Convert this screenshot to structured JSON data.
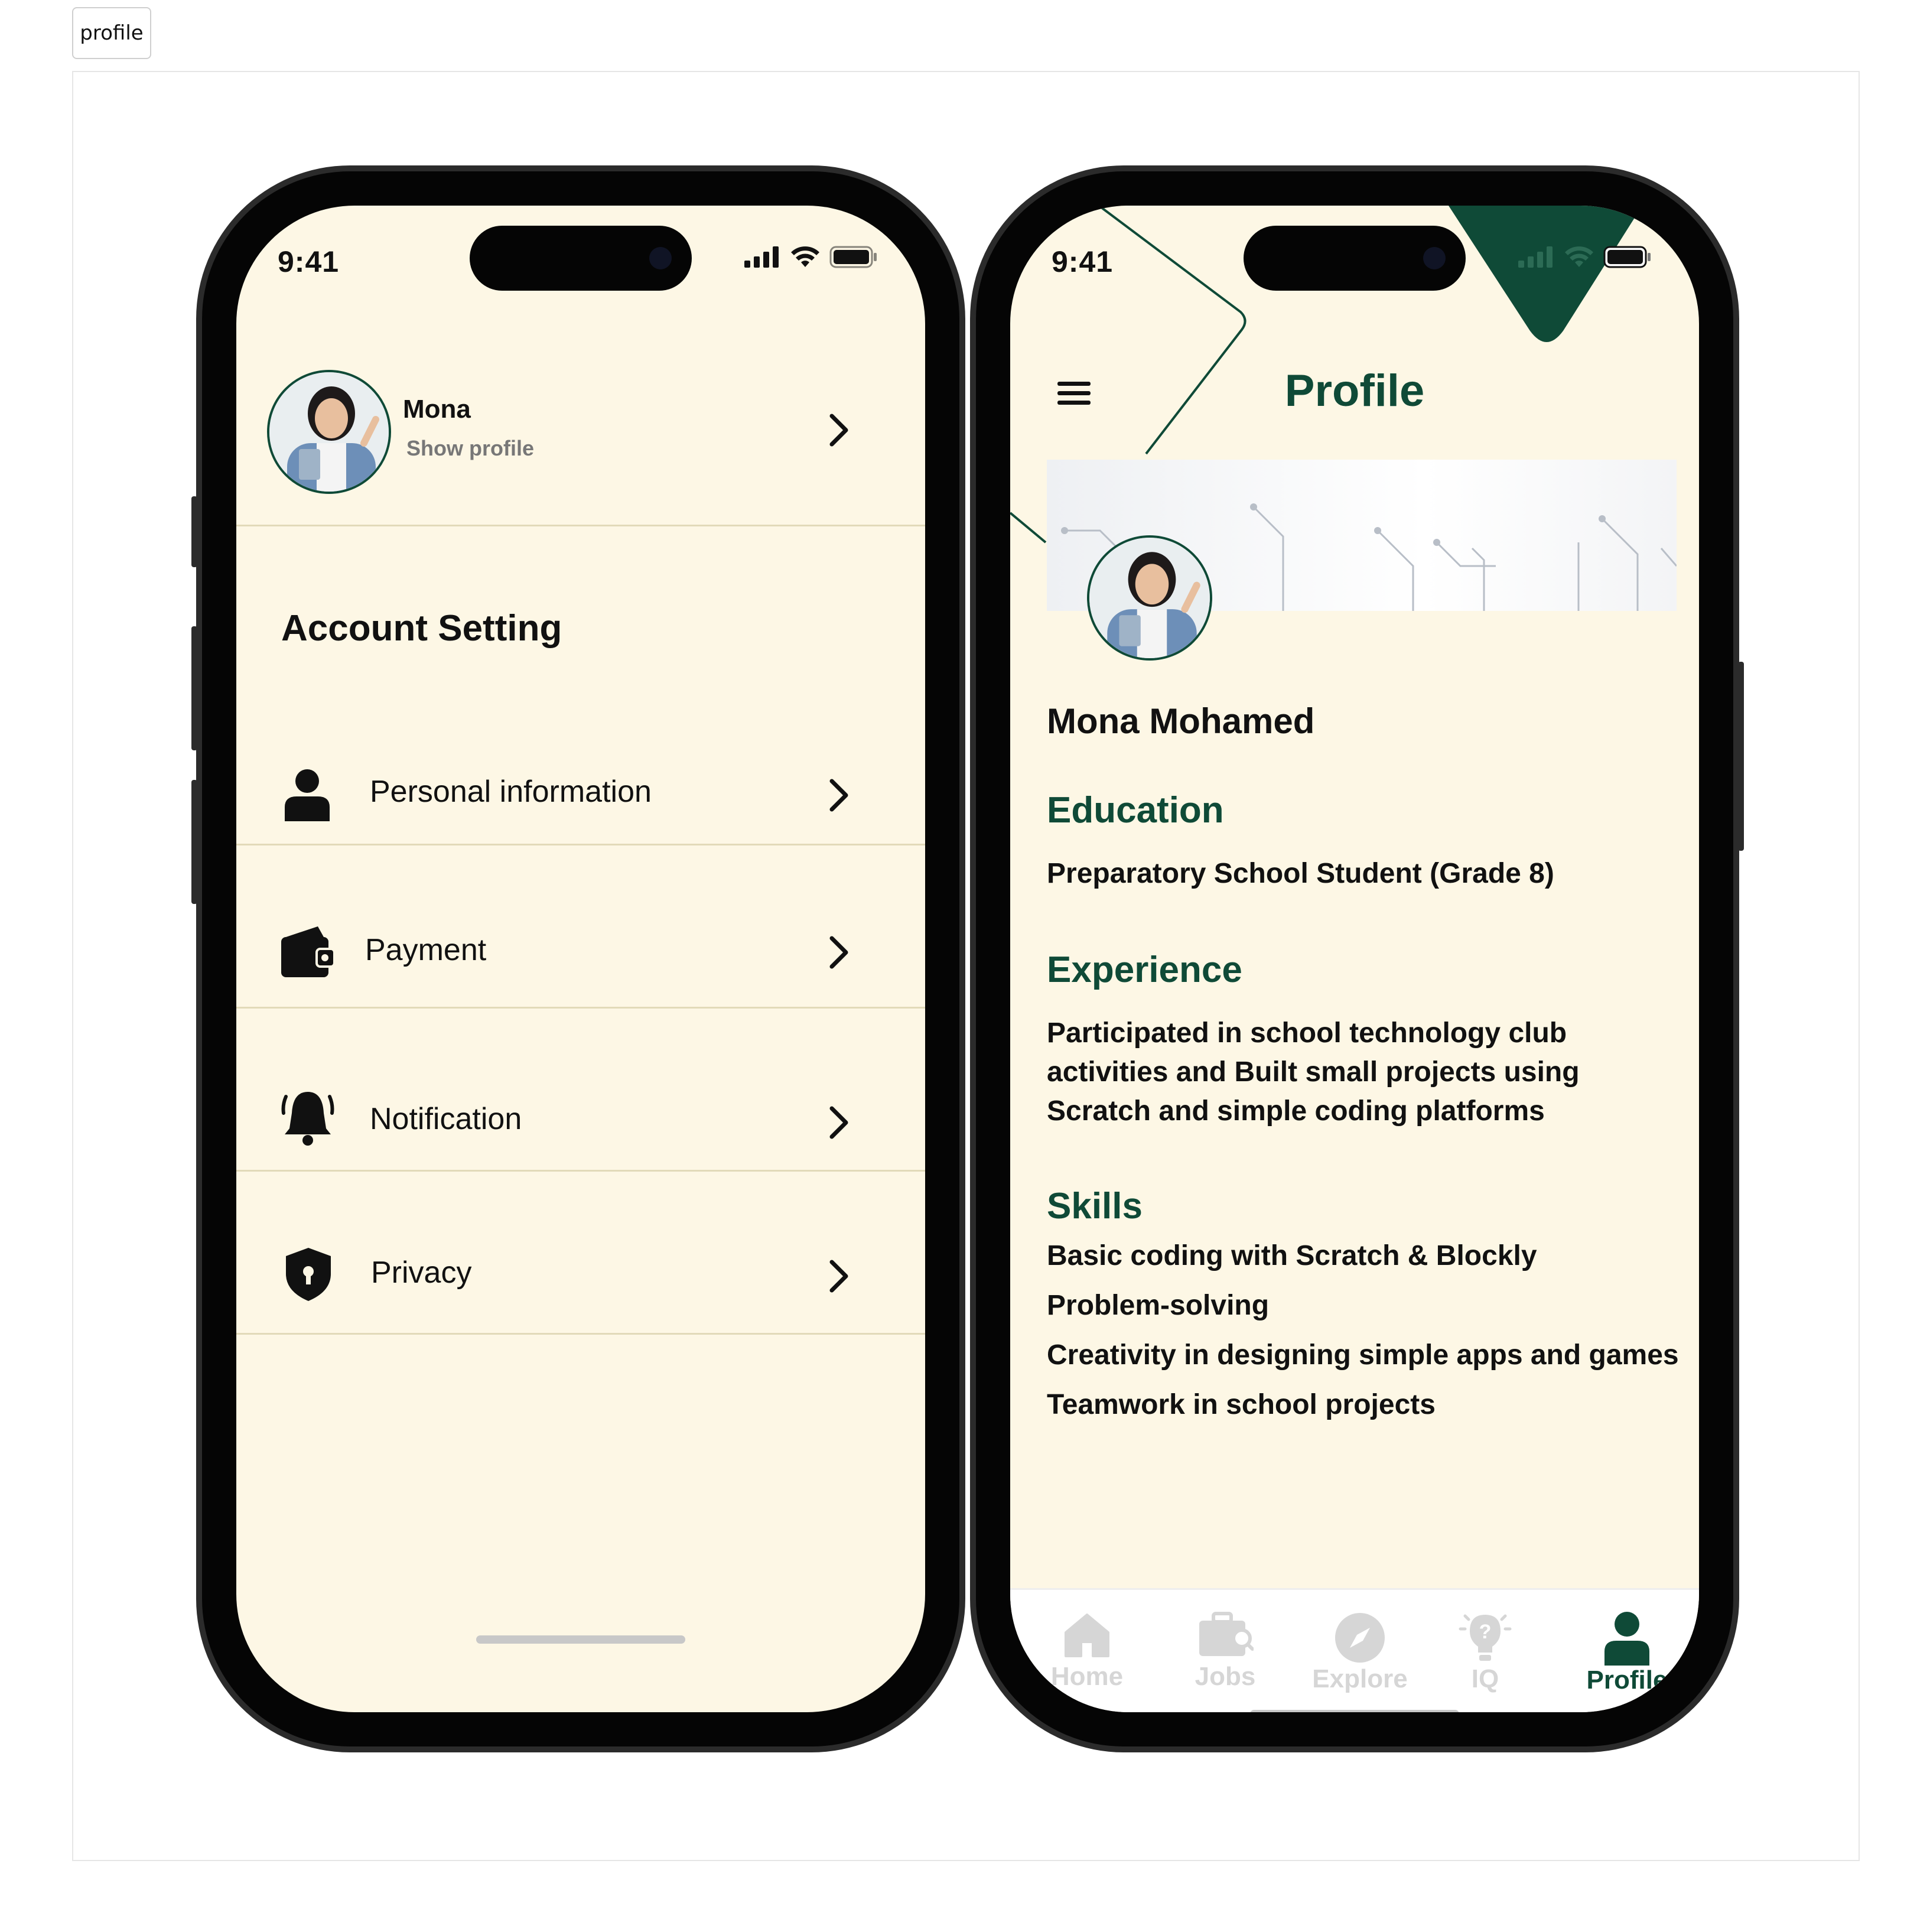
{
  "top_tag": "profile",
  "colors": {
    "brand_green": "#0f4a37",
    "screen_bg": "#fdf7e5",
    "inactive_tab": "#d6d6d6"
  },
  "left_phone": {
    "status": {
      "time": "9:41"
    },
    "profile": {
      "name": "Mona",
      "subtitle": "Show profile"
    },
    "section_title": "Account Setting",
    "rows": [
      {
        "label": "Personal information",
        "icon": "person-icon"
      },
      {
        "label": "Payment",
        "icon": "wallet-icon"
      },
      {
        "label": "Notification",
        "icon": "bell-icon"
      },
      {
        "label": "Privacy",
        "icon": "shield-icon"
      }
    ]
  },
  "right_phone": {
    "status": {
      "time": "9:41"
    },
    "header": {
      "title": "Profile",
      "menu_icon": "hamburger-icon"
    },
    "full_name": "Mona Mohamed",
    "education": {
      "heading": "Education",
      "text": "Preparatory School Student (Grade 8)"
    },
    "experience": {
      "heading": "Experience",
      "lines": [
        "Participated in school technology club",
        "activities and Built small projects using",
        "Scratch and simple coding platforms"
      ]
    },
    "skills": {
      "heading": "Skills",
      "items": [
        "Basic coding with Scratch & Blockly",
        "Problem-solving",
        "Creativity in designing simple apps and games",
        "Teamwork in school projects"
      ]
    },
    "tabs": [
      {
        "label": "Home",
        "icon": "home-icon",
        "active": false
      },
      {
        "label": "Jobs",
        "icon": "briefcase-icon",
        "active": false
      },
      {
        "label": "Explore",
        "icon": "compass-icon",
        "active": false
      },
      {
        "label": "IQ",
        "icon": "lightbulb-icon",
        "active": false
      },
      {
        "label": "Profile",
        "icon": "person-icon",
        "active": true
      }
    ]
  }
}
